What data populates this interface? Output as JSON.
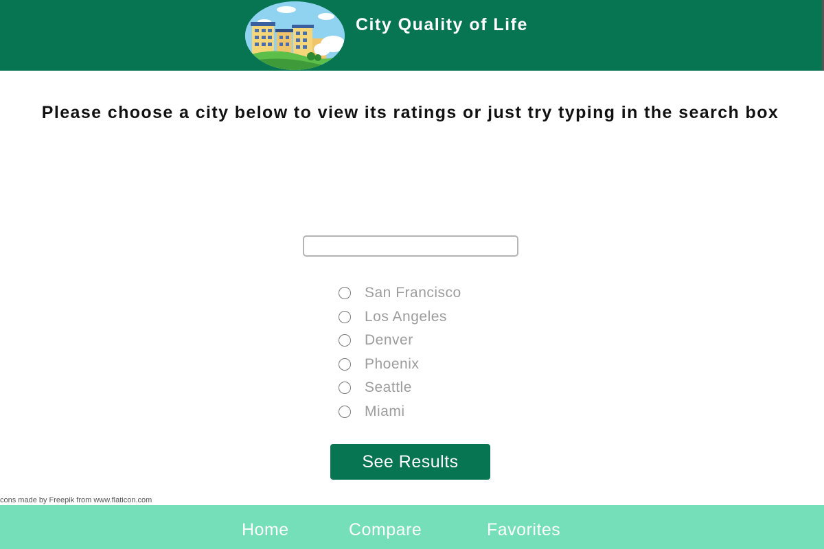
{
  "header": {
    "title": "City Quality of Life",
    "logo_icon": "city-buildings-icon",
    "background_color": "#077552"
  },
  "main": {
    "instructions": "Please choose a city below to view its ratings or just try typing in the search box",
    "search": {
      "value": "",
      "placeholder": ""
    },
    "cities": [
      {
        "label": "San Francisco",
        "selected": false
      },
      {
        "label": "Los Angeles",
        "selected": false
      },
      {
        "label": "Denver",
        "selected": false
      },
      {
        "label": "Phoenix",
        "selected": false
      },
      {
        "label": "Seattle",
        "selected": false
      },
      {
        "label": "Miami",
        "selected": false
      }
    ],
    "submit_label": "See Results",
    "button_color": "#077552"
  },
  "credit": "cons made by Freepik from www.flaticon.com",
  "footer": {
    "background_color": "#74dfb8",
    "links": [
      {
        "label": "Home"
      },
      {
        "label": "Compare"
      },
      {
        "label": "Favorites"
      }
    ]
  }
}
